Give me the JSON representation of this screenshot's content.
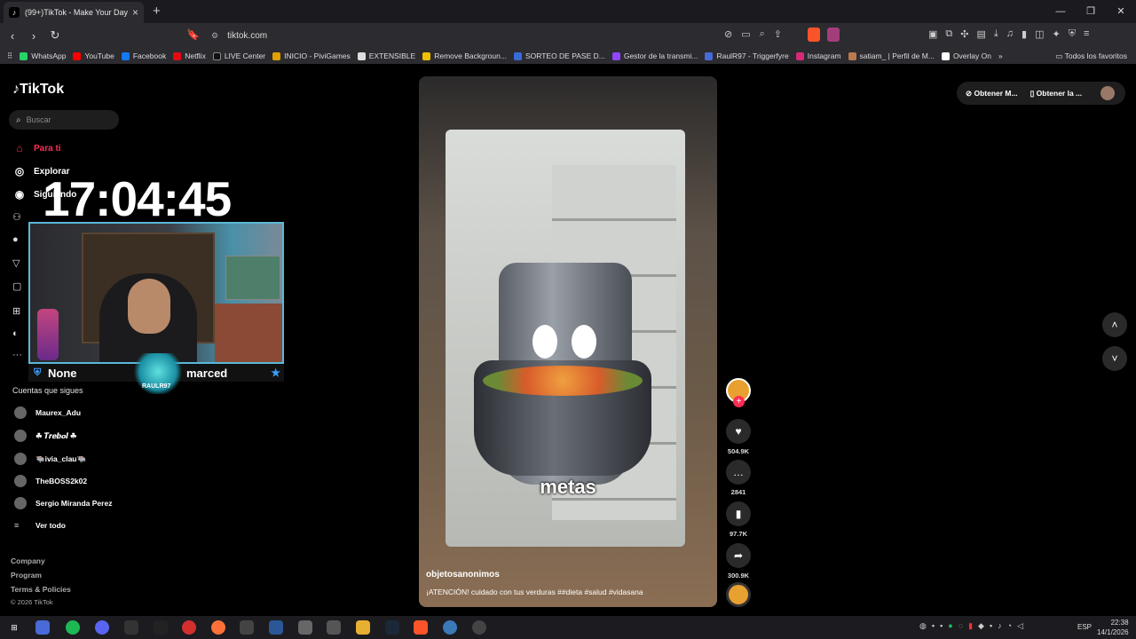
{
  "browser": {
    "tab_title": "(99+)TikTok - Make Your Day",
    "url": "tikt​ok.com",
    "bookmarks": [
      "WhatsApp",
      "YouTube",
      "Facebook",
      "Netflix",
      "LIVE Center",
      "INICIO - PiviGames",
      "EXTENSIBLE",
      "Remove Backgroun...",
      "SORTEO DE PASE D...",
      "Gestor de la transmi...",
      "RaulR97 - Triggerfyre",
      "Instagram",
      "satiam_ | Perfil de M...",
      "Overlay On"
    ],
    "bookmarks_more": "»",
    "bookmarks_folder": "Todos los favoritos"
  },
  "sidebar": {
    "logo": "TikTok",
    "search_placeholder": "Buscar",
    "nav": [
      "Para ti",
      "Explorar",
      "Siguiendo"
    ],
    "follows_title": "Cuentas que sigues",
    "follows": [
      "Maurex_Adu",
      "☘ 𝑻𝒓𝒆𝒃𝒐𝒍 ☘",
      "🐃ivia_clau🐃",
      "TheBOSS2k02",
      "Sergio Miranda Perez"
    ],
    "see_all": "Ver todo",
    "footer": [
      "Company",
      "Program",
      "Terms & Policies",
      "© 2026 TikTok"
    ]
  },
  "overlay": {
    "clock": "17:04:45",
    "name_left": "None",
    "name_right": "marced",
    "mascot_label": "RAULR97"
  },
  "video": {
    "caption_overlay": "metas",
    "username": "objetosanonimos",
    "description": "¡ATENCIÓN! cuidado con tus verduras ##dieta #salud #vidasana",
    "likes": "504.9K",
    "comments": "2841",
    "saves": "97.7K",
    "shares": "300.9K"
  },
  "topright": {
    "btn1": "Obtener M...",
    "btn2": "Obtener la ..."
  },
  "taskbar": {
    "lang": "ESP",
    "time": "22:38",
    "date": "14/1/2026"
  },
  "colors": {
    "accent": "#fe2c55",
    "overlay_border": "#5ab8d8"
  }
}
